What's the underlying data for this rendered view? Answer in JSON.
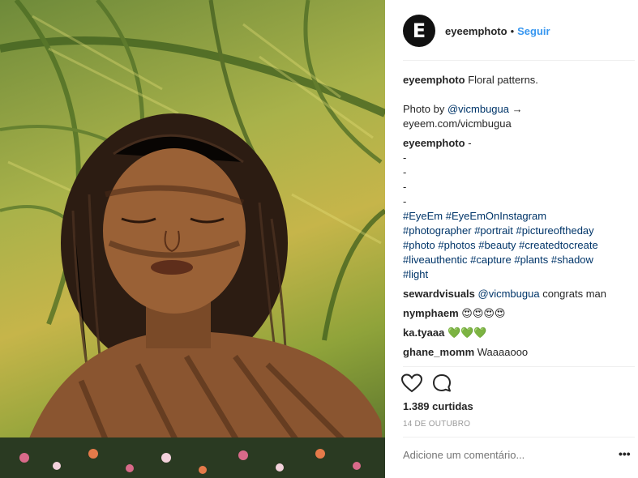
{
  "header": {
    "avatar_letter": "E",
    "username": "eyeemphoto",
    "separator": "•",
    "follow_label": "Seguir"
  },
  "caption": {
    "username": "eyeemphoto",
    "text": "Floral patterns.",
    "credit_prefix": "Photo by ",
    "credit_handle": "@vicmbugua",
    "credit_arrow": " →",
    "credit_url": "eyeem.com/vicmbugua"
  },
  "owner_comment": {
    "username": "eyeemphoto",
    "first_line": "-",
    "dashes": [
      "-",
      "-",
      "-",
      "-"
    ],
    "hashtags": [
      "#EyeEm",
      "#EyeEmOnInstagram",
      "#photographer",
      "#portrait",
      "#pictureoftheday",
      "#photo",
      "#photos",
      "#beauty",
      "#createdtocreate",
      "#liveauthentic",
      "#capture",
      "#plants",
      "#shadow",
      "#light"
    ]
  },
  "comments": [
    {
      "username": "sewardvisuals",
      "mention": "@vicmbugua",
      "text": "congrats man"
    },
    {
      "username": "nymphaem",
      "text": "😍😍😍😍"
    },
    {
      "username": "ka.tyaaa",
      "text": "💚💚💚"
    },
    {
      "username": "ghane_momm",
      "text": "Waaaaooo"
    }
  ],
  "actions": {
    "like_icon": "heart-icon",
    "comment_icon": "comment-icon"
  },
  "likes_text": "1.389 curtidas",
  "date_text": "14 DE OUTUBRO",
  "comment_box": {
    "placeholder": "Adicione um comentário...",
    "more_label": "•••"
  },
  "colors": {
    "follow_blue": "#3897f0",
    "link_blue": "#003569",
    "muted_gray": "#999999",
    "text": "#262626"
  }
}
